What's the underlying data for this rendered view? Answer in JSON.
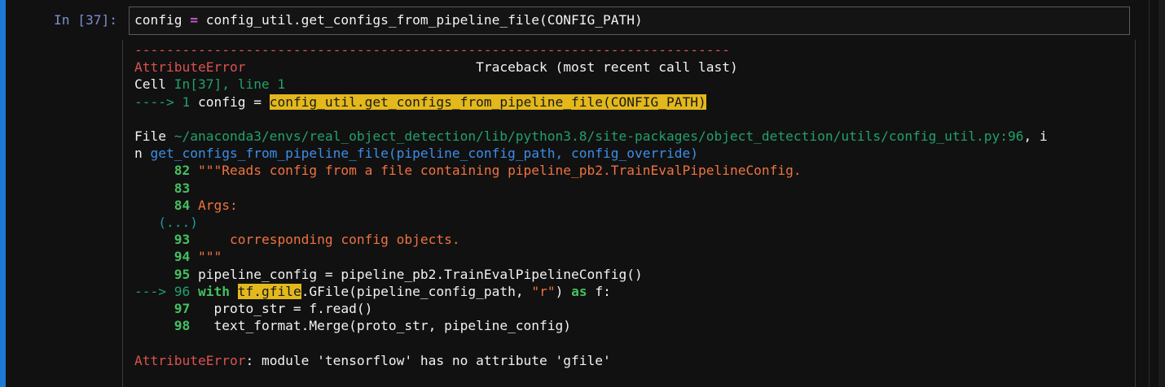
{
  "cell": {
    "prompt": "In [37]:",
    "code_var": "config",
    "code_eq": "=",
    "code_rest": "config_util.get_configs_from_pipeline_file(CONFIG_PATH)"
  },
  "traceback": {
    "dashes": "---------------------------------------------------------------------------",
    "error_name": "AttributeError",
    "spacer": "                             ",
    "header": "Traceback (most recent call last)",
    "cell_word": "Cell ",
    "cell_ref": "In[37], line 1",
    "arrow1": "----> 1",
    "line1_text": " config = ",
    "line1_hl": "config_util.get_configs_from_pipeline_file(CONFIG_PATH)",
    "file_word": "File ",
    "file_path": "~/anaconda3/envs/real_object_detection/lib/python3.8/site-packages/object_detection/utils/config_util.py:96",
    "file_suffix": ", i",
    "in_word": "n ",
    "func_name": "get_configs_from_pipeline_file",
    "func_args": "(pipeline_config_path, config_override)",
    "l82_num": "82",
    "l82_text": "\"\"\"Reads config from a file containing pipeline_pb2.TrainEvalPipelineConfig.",
    "l83_num": "83",
    "l84_num": "84",
    "l84_text": "Args:",
    "ellipsis": "(...)",
    "l93_num": "93",
    "l93_text": "    corresponding config objects.",
    "l94_num": "94",
    "l94_text": "\"\"\"",
    "l95_num": "95",
    "l95_text": "pipeline_config = pipeline_pb2.TrainEvalPipelineConfig()",
    "arrow96": "---> 96",
    "l96_kw": "with",
    "l96_hl": "tf.gfile",
    "l96_text_a": ".GFile(pipeline_config_path, ",
    "l96_str": "\"r\"",
    "l96_text_b": ") ",
    "l96_as": "as",
    "l96_text_c": " f:",
    "l97_num": "97",
    "l97_text": "  proto_str = f.read()",
    "l98_num": "98",
    "l98_text": "  text_format.Merge(proto_str, pipeline_config)",
    "final_error_name": "AttributeError",
    "final_message": ": module 'tensorflow' has no attribute 'gfile'"
  },
  "colors": {
    "accent_cell_bar": "#1e78d6",
    "error_red": "#d9534f",
    "green": "#22a06b",
    "highlight": "#e2b81c"
  }
}
